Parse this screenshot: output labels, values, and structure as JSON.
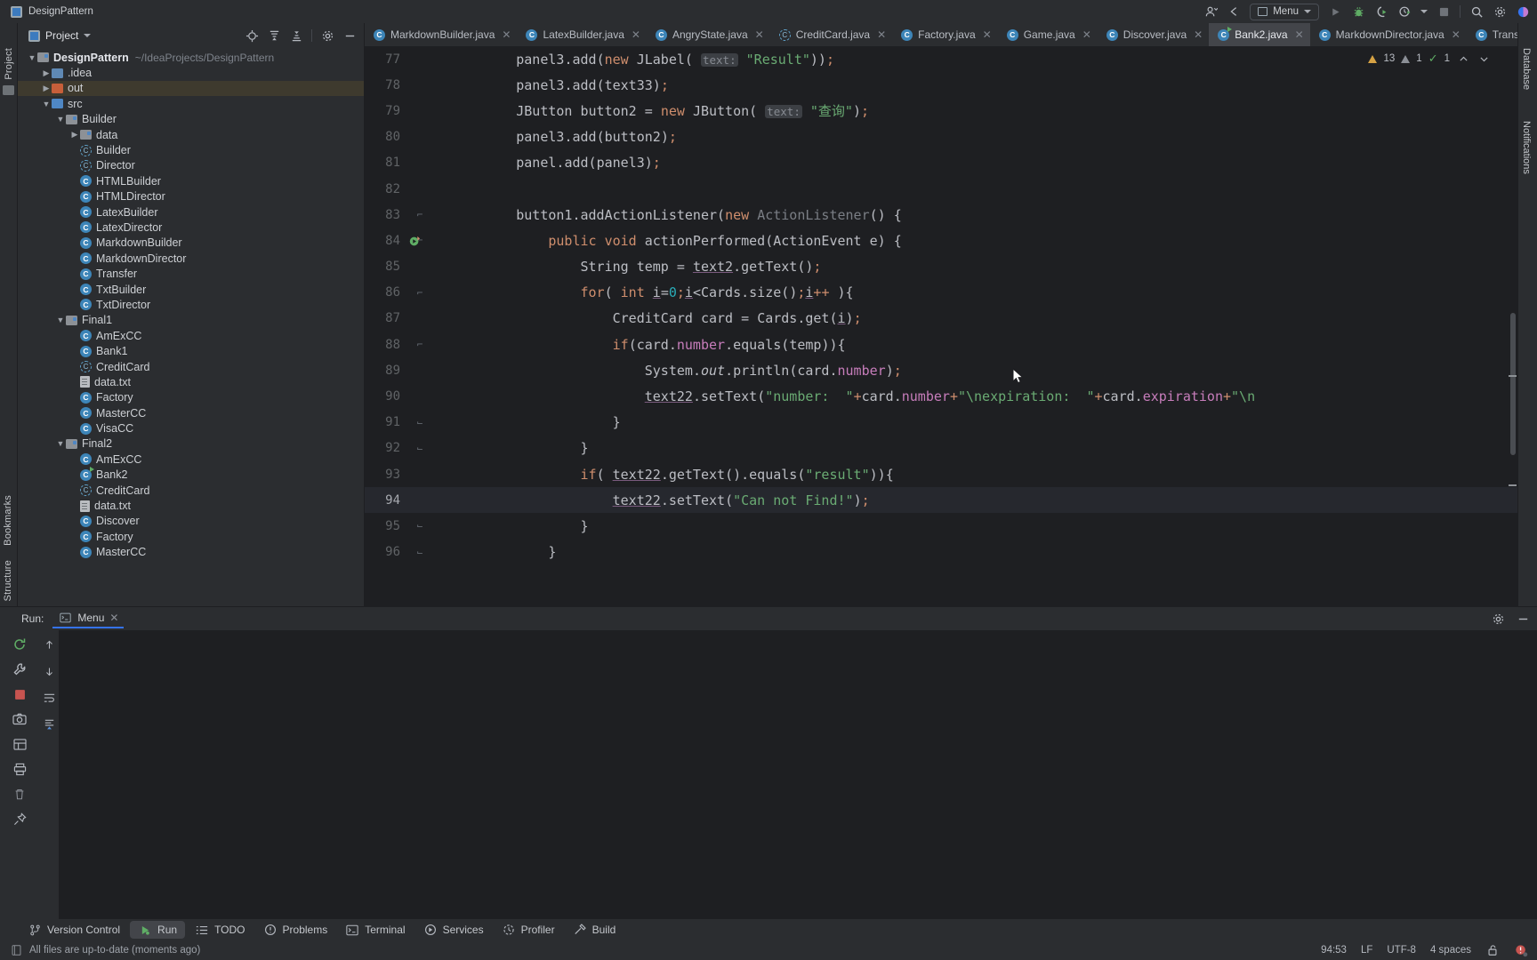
{
  "titlebar": {
    "project_name": "DesignPattern",
    "menu_label": "Menu",
    "icons": [
      "account-icon",
      "back-arrow-icon",
      "menu-icon",
      "run-icon",
      "debug-icon",
      "run-coverage-icon",
      "profile-icon",
      "dropdown-icon",
      "stop-icon",
      "search-icon",
      "settings-gear-icon",
      "ai-assistant-icon"
    ]
  },
  "left_rail": {
    "project_label": "Project",
    "bookmarks_label": "Bookmarks",
    "structure_label": "Structure"
  },
  "right_rail": {
    "database_label": "Database",
    "notifications_label": "Notifications"
  },
  "project_panel": {
    "title": "Project",
    "toolbar_icons": [
      "locate-icon",
      "expand-all-icon",
      "collapse-all-icon",
      "settings-gear-icon",
      "hide-icon"
    ],
    "tree": [
      {
        "depth": 0,
        "arrow": "v",
        "icon": "module-folder",
        "label": "DesignPattern",
        "bold": true,
        "path": "~/IdeaProjects/DesignPattern"
      },
      {
        "depth": 1,
        "arrow": ">",
        "icon": "folder",
        "label": ".idea"
      },
      {
        "depth": 1,
        "arrow": ">",
        "icon": "folder-out",
        "label": "out",
        "selected": true
      },
      {
        "depth": 1,
        "arrow": "v",
        "icon": "folder-src",
        "label": "src"
      },
      {
        "depth": 2,
        "arrow": "v",
        "icon": "package",
        "label": "Builder"
      },
      {
        "depth": 3,
        "arrow": ">",
        "icon": "package",
        "label": "data"
      },
      {
        "depth": 3,
        "arrow": "",
        "icon": "interface",
        "label": "Builder"
      },
      {
        "depth": 3,
        "arrow": "",
        "icon": "interface",
        "label": "Director"
      },
      {
        "depth": 3,
        "arrow": "",
        "icon": "class",
        "label": "HTMLBuilder"
      },
      {
        "depth": 3,
        "arrow": "",
        "icon": "class",
        "label": "HTMLDirector"
      },
      {
        "depth": 3,
        "arrow": "",
        "icon": "class",
        "label": "LatexBuilder"
      },
      {
        "depth": 3,
        "arrow": "",
        "icon": "class",
        "label": "LatexDirector"
      },
      {
        "depth": 3,
        "arrow": "",
        "icon": "class",
        "label": "MarkdownBuilder"
      },
      {
        "depth": 3,
        "arrow": "",
        "icon": "class",
        "label": "MarkdownDirector"
      },
      {
        "depth": 3,
        "arrow": "",
        "icon": "class",
        "label": "Transfer"
      },
      {
        "depth": 3,
        "arrow": "",
        "icon": "class",
        "label": "TxtBuilder"
      },
      {
        "depth": 3,
        "arrow": "",
        "icon": "class",
        "label": "TxtDirector"
      },
      {
        "depth": 2,
        "arrow": "v",
        "icon": "package",
        "label": "Final1"
      },
      {
        "depth": 3,
        "arrow": "",
        "icon": "class",
        "label": "AmExCC"
      },
      {
        "depth": 3,
        "arrow": "",
        "icon": "class",
        "label": "Bank1"
      },
      {
        "depth": 3,
        "arrow": "",
        "icon": "interface",
        "label": "CreditCard"
      },
      {
        "depth": 3,
        "arrow": "",
        "icon": "textfile",
        "label": "data.txt"
      },
      {
        "depth": 3,
        "arrow": "",
        "icon": "class",
        "label": "Factory"
      },
      {
        "depth": 3,
        "arrow": "",
        "icon": "class",
        "label": "MasterCC"
      },
      {
        "depth": 3,
        "arrow": "",
        "icon": "class",
        "label": "VisaCC"
      },
      {
        "depth": 2,
        "arrow": "v",
        "icon": "package",
        "label": "Final2"
      },
      {
        "depth": 3,
        "arrow": "",
        "icon": "class",
        "label": "AmExCC"
      },
      {
        "depth": 3,
        "arrow": "",
        "icon": "class-run",
        "label": "Bank2"
      },
      {
        "depth": 3,
        "arrow": "",
        "icon": "interface",
        "label": "CreditCard"
      },
      {
        "depth": 3,
        "arrow": "",
        "icon": "textfile",
        "label": "data.txt"
      },
      {
        "depth": 3,
        "arrow": "",
        "icon": "class",
        "label": "Discover"
      },
      {
        "depth": 3,
        "arrow": "",
        "icon": "class",
        "label": "Factory"
      },
      {
        "depth": 3,
        "arrow": "",
        "icon": "class",
        "label": "MasterCC"
      }
    ]
  },
  "editor_tabs": [
    {
      "label": "MarkdownBuilder.java",
      "icon": "class",
      "active": false
    },
    {
      "label": "LatexBuilder.java",
      "icon": "class",
      "active": false
    },
    {
      "label": "AngryState.java",
      "icon": "class",
      "active": false
    },
    {
      "label": "CreditCard.java",
      "icon": "interface",
      "active": false
    },
    {
      "label": "Factory.java",
      "icon": "class",
      "active": false
    },
    {
      "label": "Game.java",
      "icon": "class",
      "active": false
    },
    {
      "label": "Discover.java",
      "icon": "class",
      "active": false
    },
    {
      "label": "Bank2.java",
      "icon": "class-run",
      "active": true
    },
    {
      "label": "MarkdownDirector.java",
      "icon": "class",
      "active": false
    },
    {
      "label": "Transf",
      "icon": "class",
      "active": false
    }
  ],
  "inspection_widget": {
    "warnings": "13",
    "weak_warnings": "1",
    "checks": "1",
    "up_label": "^",
    "down_label": "v"
  },
  "code": {
    "current_line": 94,
    "lines": [
      {
        "n": 77,
        "text": "        panel3.add(new JLabel( text: \"Result\"));"
      },
      {
        "n": 78,
        "text": "        panel3.add(text33);"
      },
      {
        "n": 79,
        "text": "        JButton button2 = new JButton( text: \"查询\");"
      },
      {
        "n": 80,
        "text": "        panel3.add(button2);"
      },
      {
        "n": 81,
        "text": "        panel.add(panel3);"
      },
      {
        "n": 82,
        "text": ""
      },
      {
        "n": 83,
        "text": "        button1.addActionListener(new ActionListener() {"
      },
      {
        "n": 84,
        "text": "            public void actionPerformed(ActionEvent e) {"
      },
      {
        "n": 85,
        "text": "                String temp = text2.getText();"
      },
      {
        "n": 86,
        "text": "                for( int i=0;i<Cards.size();i++ ){"
      },
      {
        "n": 87,
        "text": "                    CreditCard card = Cards.get(i);"
      },
      {
        "n": 88,
        "text": "                    if(card.number.equals(temp)){"
      },
      {
        "n": 89,
        "text": "                        System.out.println(card.number);"
      },
      {
        "n": 90,
        "text": "                        text22.setText(\"number:  \"+card.number+\"\\nexpiration:  \"+card.expiration+\"\\n"
      },
      {
        "n": 91,
        "text": "                    }"
      },
      {
        "n": 92,
        "text": "                }"
      },
      {
        "n": 93,
        "text": "                if( text22.getText().equals(\"result\")){"
      },
      {
        "n": 94,
        "text": "                    text22.setText(\"Can not Find!\");"
      },
      {
        "n": 95,
        "text": "                }"
      },
      {
        "n": 96,
        "text": "            }"
      }
    ]
  },
  "run_panel": {
    "label": "Run:",
    "tab_label": "Menu",
    "tab_icon": "console-icon",
    "close_icon": "close-icon",
    "settings_icon": "settings-gear-icon",
    "minimize_icon": "minimize-icon",
    "tool_icons": [
      "rerun-icon",
      "wrench-icon",
      "stop-icon",
      "camera-icon",
      "layout-icon",
      "print-icon",
      "trash-icon",
      "pin-icon",
      "up-arrow-icon",
      "down-arrow-icon",
      "soft-wrap-icon",
      "scroll-end-icon"
    ],
    "console_text": ""
  },
  "bottom_bar": {
    "items": [
      {
        "label": "Version Control",
        "icon": "branch-icon",
        "active": false
      },
      {
        "label": "Run",
        "icon": "run-icon",
        "active": true
      },
      {
        "label": "TODO",
        "icon": "todo-icon",
        "active": false
      },
      {
        "label": "Problems",
        "icon": "problems-icon",
        "active": false
      },
      {
        "label": "Terminal",
        "icon": "terminal-icon",
        "active": false
      },
      {
        "label": "Services",
        "icon": "services-icon",
        "active": false
      },
      {
        "label": "Profiler",
        "icon": "profiler-icon",
        "active": false
      },
      {
        "label": "Build",
        "icon": "build-hammer-icon",
        "active": false
      }
    ]
  },
  "status_bar": {
    "message": "All files are up-to-date (moments ago)",
    "message_icon": "document-icon",
    "caret_position": "94:53",
    "line_separator": "LF",
    "encoding": "UTF-8",
    "indent": "4 spaces",
    "lock_icon": "unlocked-icon",
    "notification_icon": "error-notification-icon"
  },
  "colors": {
    "bg": "#2b2d30",
    "editor_bg": "#1e1f22",
    "accent": "#3573f0",
    "keyword": "#cf8e6d",
    "string": "#6aab73",
    "number": "#2aacb8",
    "field": "#c77dbb",
    "method": "#56a8f5",
    "selection_out": "#3e3a2e",
    "active_tab": "#43454a"
  }
}
